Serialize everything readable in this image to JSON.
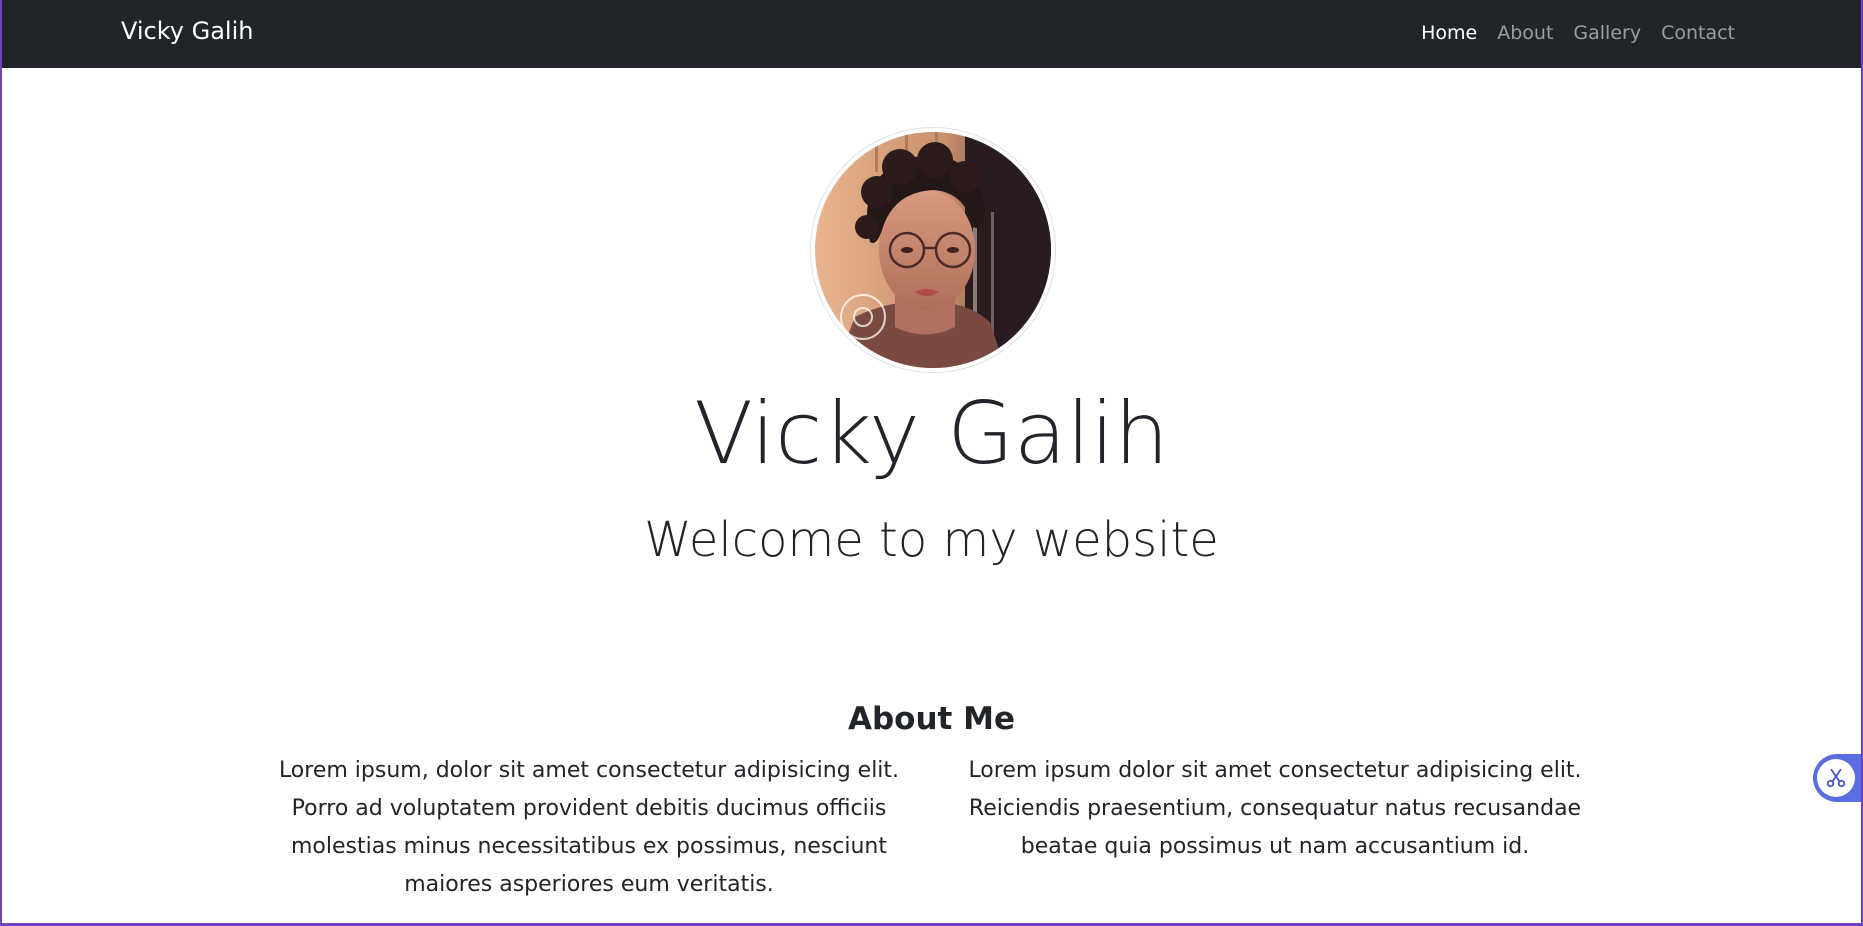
{
  "navbar": {
    "brand": "Vicky Galih",
    "links": [
      {
        "label": "Home",
        "active": true
      },
      {
        "label": "About",
        "active": false
      },
      {
        "label": "Gallery",
        "active": false
      },
      {
        "label": "Contact",
        "active": false
      }
    ]
  },
  "hero": {
    "name": "Vicky Galih",
    "subtitle": "Welcome to my website",
    "avatar_icon": "profile-photo"
  },
  "about": {
    "title": "About Me",
    "paragraphs": [
      "Lorem ipsum, dolor sit amet consectetur adipisicing elit. Porro ad voluptatem provident debitis ducimus officiis molestias minus necessitatibus ex possimus, nesciunt maiores asperiores eum veritatis.",
      "Lorem ipsum dolor sit amet consectetur adipisicing elit. Reiciendis praesentium, consequatur natus recusandae beatae quia possimus ut nam accusantium id."
    ]
  },
  "floating_widget": {
    "icon": "scissors-icon"
  },
  "colors": {
    "navbar_bg": "#212529",
    "frame_accent": "#6f42c1",
    "widget_accent": "#5b6ee1",
    "text": "#212529"
  }
}
